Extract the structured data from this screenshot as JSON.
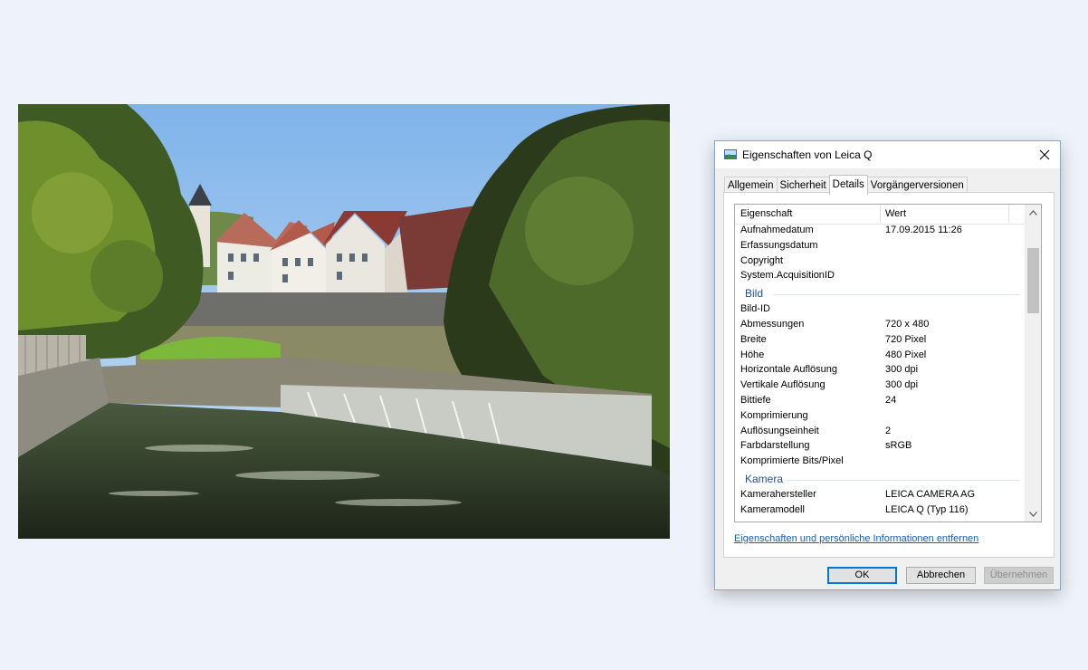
{
  "window": {
    "title": "Eigenschaften von Leica Q",
    "close_glyph": "✕"
  },
  "tabs": [
    {
      "label": "Allgemein",
      "active": false
    },
    {
      "label": "Sicherheit",
      "active": false
    },
    {
      "label": "Details",
      "active": true
    },
    {
      "label": "Vorgängerversionen",
      "active": false
    }
  ],
  "list": {
    "header_name": "Eigenschaft",
    "header_value": "Wert",
    "top_rows": [
      {
        "name": "Aufnahmedatum",
        "value": "17.09.2015 11:26"
      },
      {
        "name": "Erfassungsdatum",
        "value": ""
      },
      {
        "name": "Copyright",
        "value": ""
      },
      {
        "name": "System.AcquisitionID",
        "value": ""
      }
    ],
    "group_bild": "Bild",
    "bild_rows": [
      {
        "name": "Bild-ID",
        "value": ""
      },
      {
        "name": "Abmessungen",
        "value": "720 x 480"
      },
      {
        "name": "Breite",
        "value": "720 Pixel"
      },
      {
        "name": "Höhe",
        "value": "480 Pixel"
      },
      {
        "name": "Horizontale Auflösung",
        "value": "300 dpi"
      },
      {
        "name": "Vertikale Auflösung",
        "value": "300 dpi"
      },
      {
        "name": "Bittiefe",
        "value": "24"
      },
      {
        "name": "Komprimierung",
        "value": ""
      },
      {
        "name": "Auflösungseinheit",
        "value": "2"
      },
      {
        "name": "Farbdarstellung",
        "value": "sRGB"
      },
      {
        "name": "Komprimierte Bits/Pixel",
        "value": ""
      }
    ],
    "group_kamera": "Kamera",
    "kamera_rows": [
      {
        "name": "Kamerahersteller",
        "value": "LEICA CAMERA AG"
      },
      {
        "name": "Kameramodell",
        "value": "LEICA Q (Typ 116)"
      }
    ]
  },
  "remove_link": "Eigenschaften und persönliche Informationen entfernen",
  "buttons": {
    "ok": "OK",
    "cancel": "Abbrechen",
    "apply": "Übernehmen"
  },
  "icons": {
    "title_icon": "image-file-icon",
    "close": "close-icon",
    "scroll_up": "chevron-up-icon",
    "scroll_down": "chevron-down-icon"
  },
  "colors": {
    "background": "#eef3fb",
    "group_label": "#1f4fa8",
    "link": "#0a5fc8",
    "focus_border": "#0078d7"
  }
}
